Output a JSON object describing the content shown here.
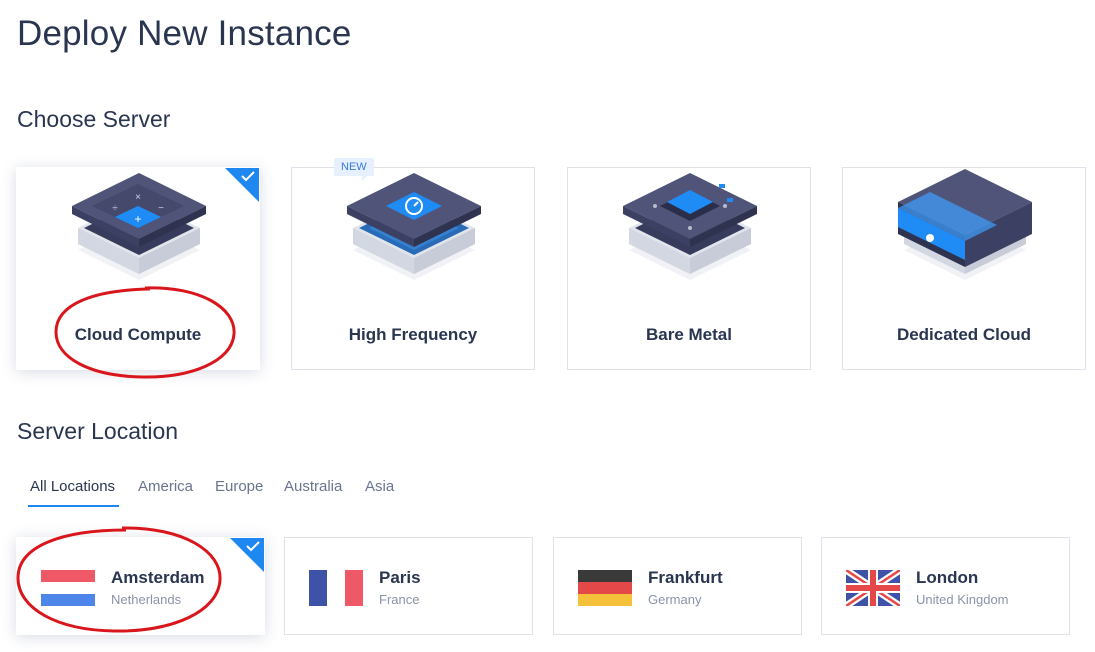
{
  "page": {
    "title": "Deploy New Instance"
  },
  "choose_server": {
    "title": "Choose Server",
    "badge": "NEW",
    "cards": [
      {
        "label": "Cloud Compute",
        "selected": true
      },
      {
        "label": "High Frequency",
        "selected": false
      },
      {
        "label": "Bare Metal",
        "selected": false
      },
      {
        "label": "Dedicated Cloud",
        "selected": false
      }
    ]
  },
  "server_location": {
    "title": "Server Location",
    "tabs": [
      {
        "label": "All Locations",
        "active": true
      },
      {
        "label": "America"
      },
      {
        "label": "Europe"
      },
      {
        "label": "Australia"
      },
      {
        "label": "Asia"
      }
    ],
    "locations": [
      {
        "city": "Amsterdam",
        "country": "Netherlands",
        "flag": "netherlands-flag",
        "selected": true
      },
      {
        "city": "Paris",
        "country": "France",
        "flag": "france-flag",
        "selected": false
      },
      {
        "city": "Frankfurt",
        "country": "Germany",
        "flag": "germany-flag",
        "selected": false
      },
      {
        "city": "London",
        "country": "United Kingdom",
        "flag": "united-kingdom-flag",
        "selected": false
      }
    ]
  },
  "colors": {
    "accent": "#1e88f0",
    "annotation": "#d9161c",
    "heading": "#2a3550"
  }
}
